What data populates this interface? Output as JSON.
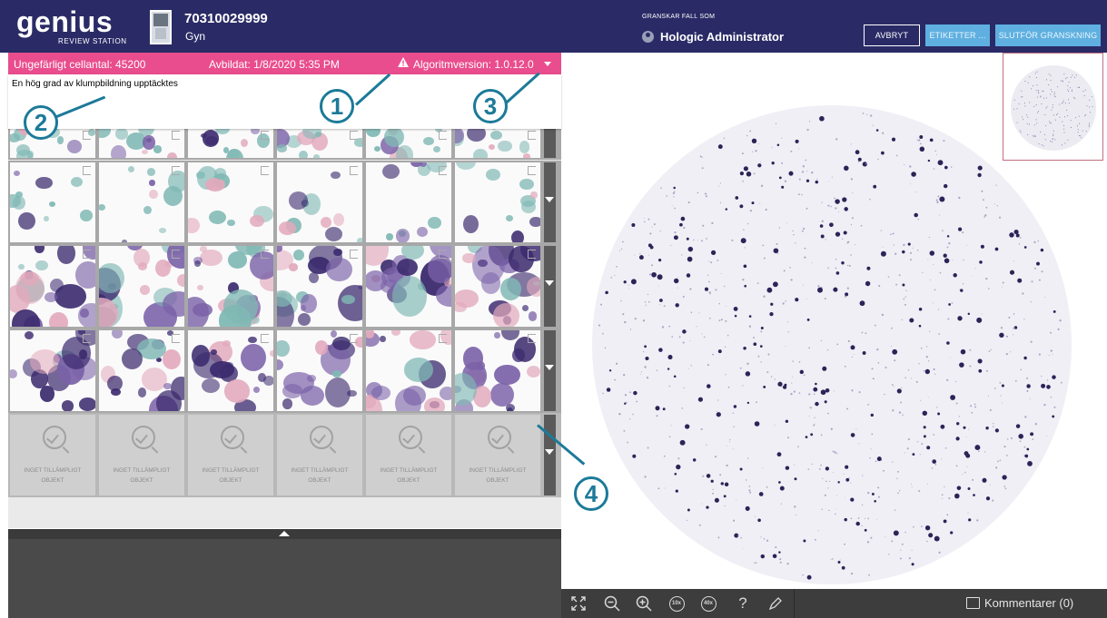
{
  "header": {
    "logo_word": "genius",
    "logo_sub": "REVIEW STATION",
    "case_id": "70310029999",
    "case_type": "Gyn",
    "reviewing_label": "GRANSKAR FALL SOM",
    "user_name": "Hologic Administrator",
    "buttons": {
      "cancel": "AVBRYT",
      "labels": "ETIKETTER ...",
      "finish": "SLUTFÖR GRANSKNING"
    }
  },
  "alert": {
    "cell_count": "Ungefärligt cellantal: 45200",
    "imaged": "Avbildat: 1/8/2020 5:35 PM",
    "algorithm": "Algoritmversion: 1.0.12.0",
    "message": "En hög grad av klumpbildning upptäcktes",
    "warning_icon": "warning-triangle-icon",
    "colors": {
      "bar": "#e94d8d",
      "header": "#2a2b66",
      "button": "#5fb0e0",
      "callout": "#1c7a98"
    }
  },
  "gallery": {
    "na_label_1": "INGET TILLÄMPLIGT",
    "na_label_2": "OBJEKT"
  },
  "toolbar": {
    "tools": [
      "fit-icon",
      "zoom-out-icon",
      "zoom-in-icon",
      "zoom-10x-icon",
      "zoom-40x-icon",
      "help-icon",
      "pen-icon"
    ],
    "zoom10": "10x",
    "zoom40": "40x",
    "help": "?",
    "comments": "Kommentarer (0)"
  },
  "callouts": [
    "1",
    "2",
    "3",
    "4"
  ]
}
